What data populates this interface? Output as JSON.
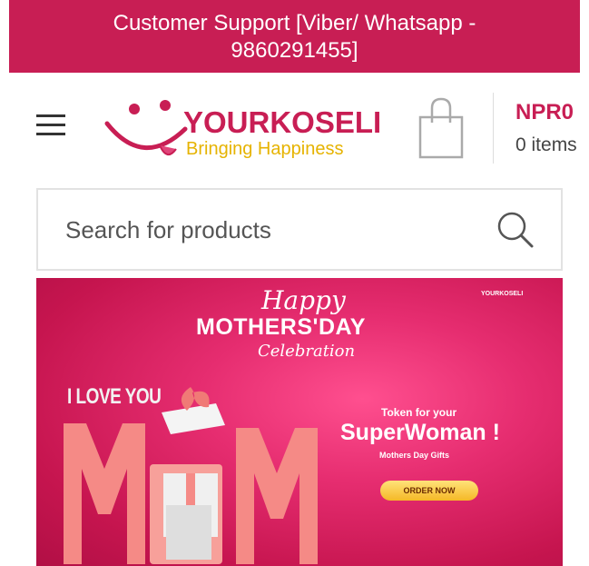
{
  "topbar": {
    "line1": "Customer Support [Viber/ Whatsapp -",
    "line2": "9860291455]"
  },
  "header": {
    "logo_title": "YOURKOSELI",
    "logo_tagline": "Bringing Happiness",
    "cart_total": "NPR0",
    "cart_count": "0 items",
    "icons": [
      "menu-icon",
      "smile-logo-icon",
      "shopping-bag-icon"
    ]
  },
  "search": {
    "placeholder": "Search for products",
    "icon": "search-icon"
  },
  "banner": {
    "happy": "Happy",
    "mothers_day": "MOTHERS'DAY",
    "celebration": "Celebration",
    "small_logo": "YOURKOSELI",
    "i_love_you": "I LOVE YOU",
    "mom": "MOM",
    "token": "Token for your",
    "superwoman": "SuperWoman !",
    "gifts": "Mothers Day Gifts",
    "order_button": "ORDER NOW",
    "colors": {
      "background": "#d81e5b",
      "letters": "#f58a86",
      "button": "#f5c842"
    }
  },
  "colors": {
    "brand": "#c81e54",
    "tagline": "#e6b300"
  }
}
